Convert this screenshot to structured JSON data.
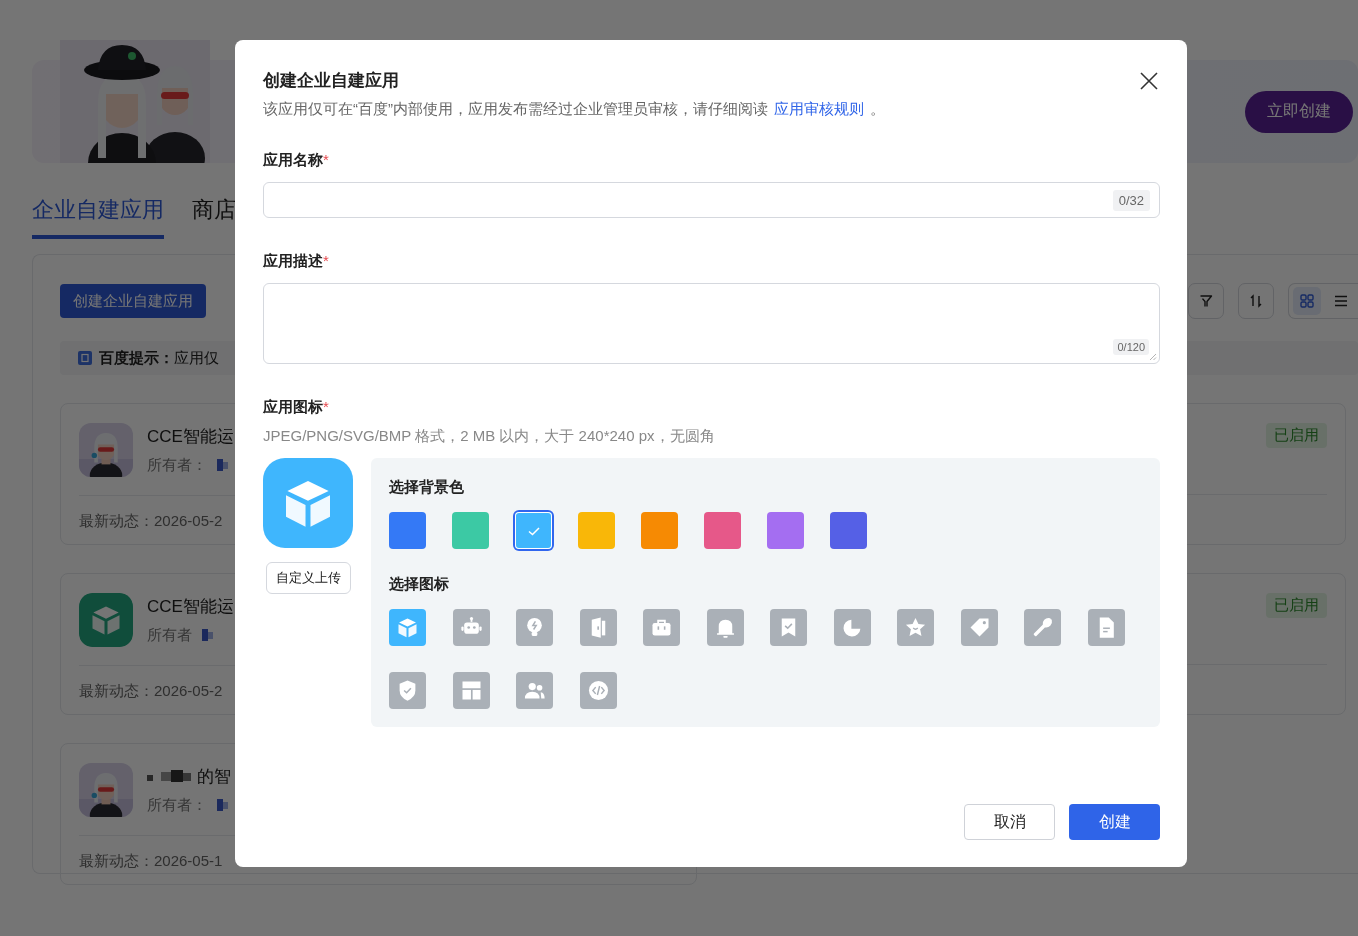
{
  "banner": {
    "button": "立即创建"
  },
  "tabs": [
    {
      "label": "企业自建应用",
      "selected": true
    },
    {
      "label": "商店",
      "selected": false
    }
  ],
  "toolbar": {
    "create_button": "创建企业自建应用",
    "view_modes": [
      {
        "selected": true
      },
      {
        "selected": false
      }
    ]
  },
  "tip": {
    "label": "百度提示：",
    "text": "应用仅"
  },
  "app_cards": [
    {
      "name": "CCE智能运",
      "name_blurred": false,
      "owner_label": "所有者：",
      "activity": "最新动态：2026-05-2"
    },
    {
      "name": "CCE智能运",
      "name_blurred": false,
      "owner_label": "所有者",
      "activity": "最新动态：2026-05-2",
      "avatar": {
        "kind": "cube"
      }
    },
    {
      "name": "的智",
      "name_blurred": true,
      "owner_label": "所有者：",
      "activity": "最新动态：2026-05-1"
    }
  ],
  "side_cards": [
    {
      "status": "已启用"
    },
    {
      "status": "已启用"
    }
  ],
  "dialog": {
    "title": "创建企业自建应用",
    "notice": "该应用仅可在“百度”内部使用，应用发布需经过企业管理员审核，请仔细阅读",
    "notice_link": "应用审核规则",
    "notice_end": "。",
    "fields": [
      {
        "label": "应用名称",
        "required_mark": "*",
        "kind": "input",
        "counter": "0/32"
      },
      {
        "label": "应用描述",
        "required_mark": "*",
        "kind": "textarea",
        "counter": "0/120"
      }
    ],
    "icon_picker": {
      "label": "应用图标",
      "required_mark": "*",
      "hint": "JPEG/PNG/SVG/BMP 格式，2 MB 以内，大于 240*240 px，无圆角",
      "upload_button": "自定义上传",
      "color_title": "选择背景色",
      "colors": [
        {
          "color": "#3479f6",
          "selected": false
        },
        {
          "color": "#3cc9a4",
          "selected": false
        },
        {
          "color": "#3fb6fd",
          "selected": true
        },
        {
          "color": "#f9b708",
          "selected": false
        },
        {
          "color": "#f68a03",
          "selected": false
        },
        {
          "color": "#e65889",
          "selected": false
        },
        {
          "color": "#a46ef1",
          "selected": false
        },
        {
          "color": "#5560e6",
          "selected": false
        }
      ],
      "icon_title": "选择图标",
      "icons": [
        {
          "selected": true
        },
        {
          "selected": false
        },
        {
          "selected": false
        },
        {
          "selected": false
        },
        {
          "selected": false
        },
        {
          "selected": false
        },
        {
          "selected": false
        },
        {
          "selected": false
        },
        {
          "selected": false
        },
        {
          "selected": false
        },
        {
          "selected": false
        },
        {
          "selected": false
        },
        {
          "selected": false
        },
        {
          "selected": false
        },
        {
          "selected": false
        },
        {
          "selected": false
        }
      ]
    },
    "buttons": [
      {
        "label": "取消",
        "kind": "secondary"
      },
      {
        "label": "创建",
        "kind": "primary"
      }
    ]
  }
}
